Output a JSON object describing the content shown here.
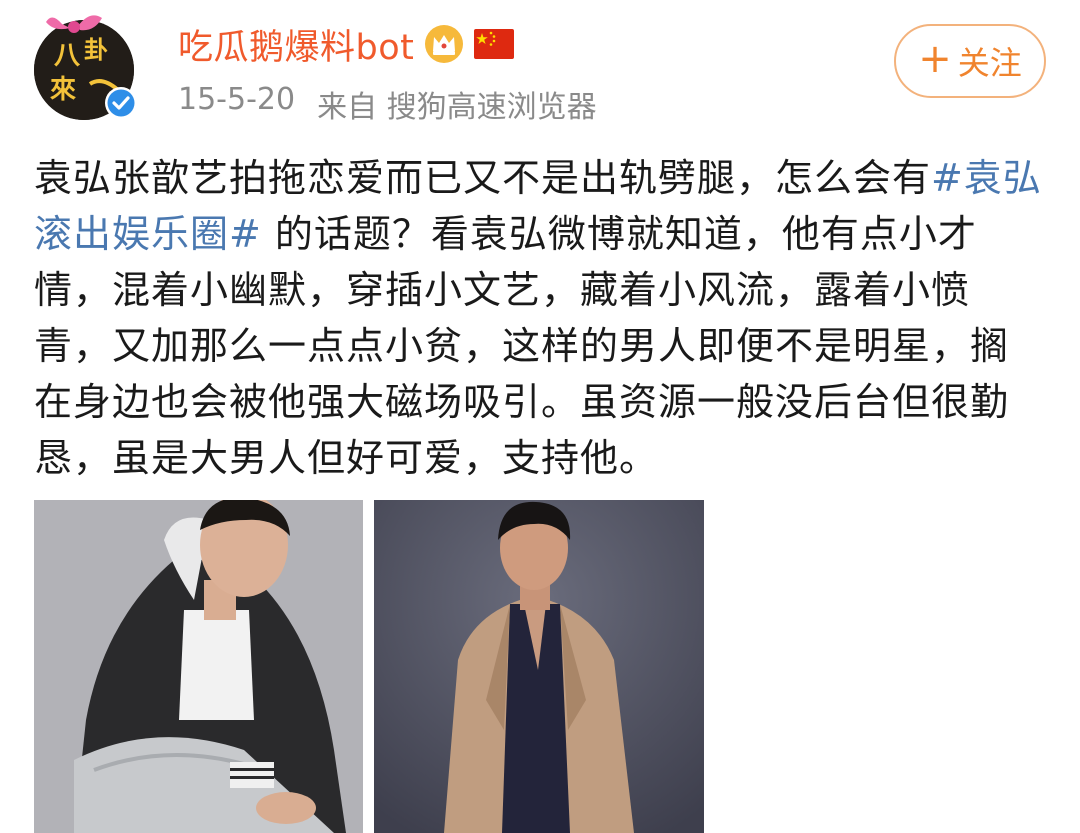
{
  "post": {
    "author": {
      "name": "吃瓜鹅爆料bot",
      "avatar_icon": "avatar-image",
      "verified_icon": "verified-badge-icon",
      "badges": [
        "crown-icon",
        "china-flag-icon"
      ]
    },
    "date": "15-5-20",
    "source": "来自 搜狗高速浏览器",
    "follow_button": {
      "plus": "+",
      "label": "关注"
    },
    "text": {
      "part1": "袁弘张歆艺拍拖恋爱而已又不是出轨劈腿，怎么会有",
      "hashtag": "#袁弘滚出娱乐圈#",
      "part2": " 的话题？看袁弘微博就知道，他有点小才情，混着小幽默，穿插小文艺，藏着小风流，露着小愤青，又加那么一点点小贫，这样的男人即便不是明星，搁在身边也会被他强大磁场吸引。虽资源一般没后台但很勤恳，虽是大男人但好可爱，支持他。"
    },
    "images": [
      "photo-man-black-jacket",
      "photo-man-tan-blazer"
    ]
  },
  "colors": {
    "username": "#f05a2c",
    "hashtag": "#4a78b0",
    "meta": "#8a8a8a",
    "follow": "#f0842e",
    "follow_border": "#f3b27c",
    "verified": "#2e8ee8"
  }
}
